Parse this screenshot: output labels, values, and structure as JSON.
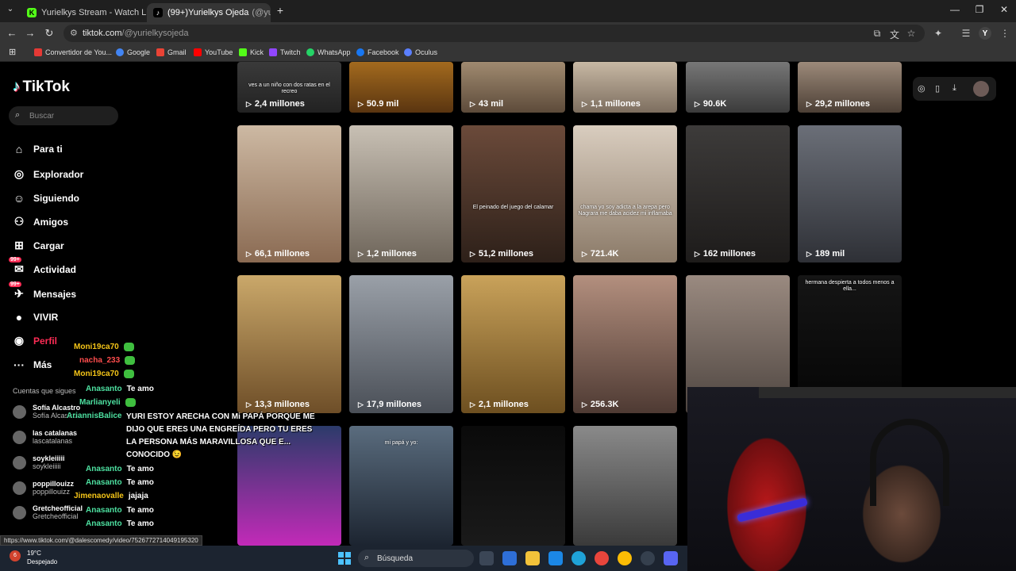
{
  "tabs": [
    {
      "title": "Yurielkys Stream - Watch Live o",
      "favicon": "K",
      "color": "#53fc18"
    },
    {
      "title": "(99+)Yurielkys Ojeda",
      "extra": "(@yur",
      "favicon": "♪",
      "color": "#000000"
    }
  ],
  "toolbar": {
    "url_domain": "tiktok.com",
    "url_path": "/@yurielkysojeda",
    "profile_initial": "Y"
  },
  "bookmarks": [
    {
      "label": "Convertidor de You...",
      "color": "#e53935"
    },
    {
      "label": "Google",
      "color": "#4285f4"
    },
    {
      "label": "Gmail",
      "color": "#ea4335"
    },
    {
      "label": "YouTube",
      "color": "#ff0000"
    },
    {
      "label": "Kick",
      "color": "#53fc18"
    },
    {
      "label": "Twitch",
      "color": "#9146ff"
    },
    {
      "label": "WhatsApp",
      "color": "#25d366"
    },
    {
      "label": "Facebook",
      "color": "#1877f2"
    },
    {
      "label": "Oculus",
      "color": "#5b7fff"
    }
  ],
  "tiktok": {
    "logo": "TikTok",
    "search_placeholder": "Buscar",
    "nav": [
      {
        "label": "Para ti",
        "icon": "home-icon",
        "glyph": "⌂"
      },
      {
        "label": "Explorador",
        "icon": "compass-icon",
        "glyph": "◎"
      },
      {
        "label": "Siguiendo",
        "icon": "user-follow-icon",
        "glyph": "☺"
      },
      {
        "label": "Amigos",
        "icon": "friends-icon",
        "glyph": "⚇"
      },
      {
        "label": "Cargar",
        "icon": "upload-icon",
        "glyph": "⊞"
      },
      {
        "label": "Actividad",
        "icon": "activity-icon",
        "glyph": "✉",
        "badge": "99+"
      },
      {
        "label": "Mensajes",
        "icon": "messages-icon",
        "glyph": "✈",
        "badge": "99+"
      },
      {
        "label": "VIVIR",
        "icon": "live-icon",
        "glyph": "●"
      },
      {
        "label": "Perfil",
        "icon": "profile-icon",
        "glyph": "◉"
      },
      {
        "label": "Más",
        "icon": "more-icon",
        "glyph": "···"
      }
    ],
    "following_label": "Cuentas que sigues",
    "following": [
      {
        "name": "Sofía Alcastro",
        "handle": "Sofía Alcastro"
      },
      {
        "name": "las catalanas",
        "handle": "lascatalanas"
      },
      {
        "name": "soykleiiiii",
        "handle": "soykleiiiii"
      },
      {
        "name": "poppillouizz",
        "handle": "poppillouizz"
      },
      {
        "name": "Gretcheofficial",
        "handle": "Gretcheofficial"
      }
    ],
    "videos": [
      {
        "views": "2,4 millones",
        "caption": "ves a un niño con dos ratas en el recreo"
      },
      {
        "views": "50.9 mil",
        "caption": ""
      },
      {
        "views": "43 mil",
        "caption": ""
      },
      {
        "views": "1,1 millones",
        "caption": ""
      },
      {
        "views": "90.6K",
        "caption": ""
      },
      {
        "views": "29,2 millones",
        "caption": ""
      },
      {
        "views": "66,1 millones",
        "caption": ""
      },
      {
        "views": "1,2 millones",
        "caption": ""
      },
      {
        "views": "51,2 millones",
        "caption": "El peinado del juego del calamar"
      },
      {
        "views": "721.4K",
        "caption": "chama yo soy adicta a la arepa pero Nagrara me daba acidez mi inflamaba"
      },
      {
        "views": "162 millones",
        "caption": ""
      },
      {
        "views": "189 mil",
        "caption": ""
      },
      {
        "views": "13,3 millones",
        "caption": ""
      },
      {
        "views": "17,9 millones",
        "caption": ""
      },
      {
        "views": "2,1 millones",
        "caption": ""
      },
      {
        "views": "256.3K",
        "caption": ""
      },
      {
        "views": "",
        "caption": ""
      },
      {
        "views": "",
        "caption": "hermana despierta a todos menos a ella..."
      },
      {
        "views": "",
        "caption": ""
      },
      {
        "views": "",
        "caption": "mi papá y yo:"
      },
      {
        "views": "",
        "caption": ""
      },
      {
        "views": "",
        "caption": ""
      }
    ]
  },
  "chat": [
    {
      "user": "Moni19ca70",
      "color": "#f5c518",
      "msg": "",
      "emote": true
    },
    {
      "user": "nacha_233",
      "color": "#ff4d4d",
      "msg": "",
      "emote": true
    },
    {
      "user": "Moni19ca70",
      "color": "#f5c518",
      "msg": "",
      "emote": true
    },
    {
      "user": "Anasanto",
      "color": "#4de0a0",
      "msg": "Te amo"
    },
    {
      "user": "Marlianyeli",
      "color": "#4de0a0",
      "msg": "",
      "emote": true
    },
    {
      "user": "AriannisBalice",
      "color": "#4de0a0",
      "msg": ""
    },
    {
      "user": "Anasanto",
      "color": "#4de0a0",
      "msg": "Te amo"
    },
    {
      "user": "Anasanto",
      "color": "#4de0a0",
      "msg": "Te amo"
    },
    {
      "user": "Jimenaovalle",
      "color": "#f5c518",
      "msg": "jajaja"
    },
    {
      "user": "Anasanto",
      "color": "#4de0a0",
      "msg": "Te amo"
    },
    {
      "user": "Anasanto",
      "color": "#4de0a0",
      "msg": "Te amo"
    }
  ],
  "long_message": "YURI ESTOY ARECHA CON Mi PAPÁ PORQUE ME DIJO QUE ERES UNA ENGREÍDA PERO TU ERES LA PERSONA MÁS MARAVILLOSA QUE E... CONOCIDO 😉",
  "status_url": "https://www.tiktok.com/@dalescomedy/video/7526772714049195320",
  "taskbar": {
    "temp": "19°C",
    "weather": "Despejado",
    "search_placeholder": "Búsqueda"
  }
}
